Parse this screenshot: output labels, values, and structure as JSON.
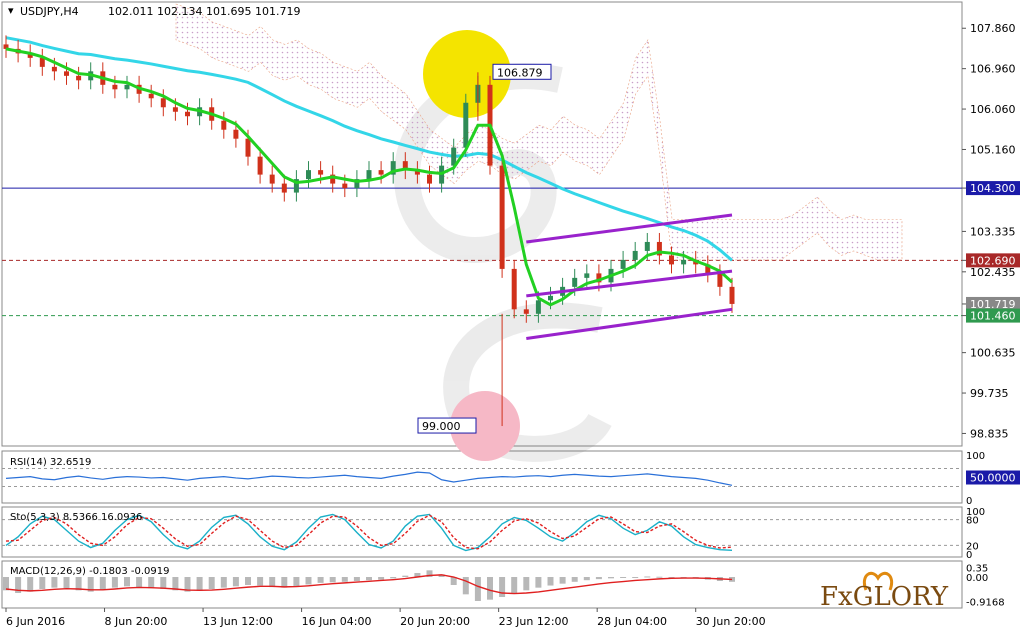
{
  "header": {
    "symbol": "USDJPY,H4",
    "quote": "102.011 102.134 101.695 101.719"
  },
  "brand": {
    "name": "FxGlory",
    "text": "FxGLORY"
  },
  "colors": {
    "bull": "#2e8b57",
    "bear": "#d0311b",
    "ma_green": "#22d022",
    "ma_cyan": "#33d6e8",
    "channel": "#9922cc",
    "level_blue": "#1a1aa8",
    "level_red": "#a82828",
    "level_green": "#2f9a4f",
    "rsi": "#2a70d8",
    "stoch_main": "#1ab0c8",
    "stoch_signal": "#e02020",
    "macd_hist": "#b8b8b8",
    "macd_signal": "#e02020"
  },
  "chart_data": [
    {
      "type": "candlestick",
      "title": "USDJPY,H4",
      "x_labels": [
        "6 Jun 2016",
        "8 Jun 20:00",
        "13 Jun 12:00",
        "16 Jun 04:00",
        "20 Jun 20:00",
        "23 Jun 12:00",
        "28 Jun 04:00",
        "30 Jun 20:00"
      ],
      "y_ticks": [
        "107.860",
        "106.960",
        "106.060",
        "105.160",
        "104.300",
        "103.335",
        "102.690",
        "102.435",
        "101.719",
        "101.460",
        "100.635",
        "99.735",
        "98.835"
      ],
      "ylim": [
        98.6,
        108.4
      ],
      "levels": [
        {
          "name": "resistance",
          "value": 104.3,
          "label": "104.300",
          "style": "solid",
          "color": "#1a1aa8"
        },
        {
          "name": "pivot",
          "value": 102.69,
          "label": "102.690",
          "style": "dashed",
          "color": "#a82828"
        },
        {
          "name": "last",
          "value": 101.719,
          "label": "101.719",
          "style": "none",
          "color": "#888888"
        },
        {
          "name": "support",
          "value": 101.46,
          "label": "101.460",
          "style": "dashed",
          "color": "#2f9a4f"
        }
      ],
      "annotations": [
        {
          "text": "106.879",
          "value": 106.879,
          "type": "high"
        },
        {
          "text": "99.000",
          "value": 99.0,
          "type": "low"
        }
      ],
      "close_path": [
        107.4,
        107.3,
        107.2,
        107.0,
        106.9,
        106.8,
        106.7,
        106.9,
        106.6,
        106.5,
        106.6,
        106.4,
        106.3,
        106.1,
        106.0,
        105.9,
        106.1,
        105.8,
        105.6,
        105.4,
        105.0,
        104.6,
        104.4,
        104.2,
        104.5,
        104.7,
        104.6,
        104.4,
        104.3,
        104.5,
        104.7,
        104.6,
        104.9,
        104.7,
        104.6,
        104.4,
        104.8,
        105.2,
        106.2,
        106.6,
        104.8,
        102.5,
        101.6,
        101.5,
        101.8,
        101.9,
        102.1,
        102.3,
        102.4,
        102.2,
        102.5,
        102.7,
        102.9,
        103.1,
        102.8,
        102.6,
        102.7,
        102.6,
        102.4,
        102.1,
        101.72
      ],
      "ichimoku_cloud": true,
      "moving_averages": [
        "fast",
        "slow"
      ],
      "channel": {
        "upper": [
          103.1,
          103.7
        ],
        "lower": [
          100.95,
          101.6
        ],
        "middle": [
          101.9,
          102.45
        ]
      }
    },
    {
      "type": "line",
      "title": "RSI(14) 32.6519",
      "y_ticks": [
        "100",
        "50.0000",
        "0"
      ],
      "ylim": [
        0,
        100
      ],
      "values": [
        48,
        50,
        52,
        47,
        45,
        50,
        53,
        49,
        46,
        50,
        52,
        51,
        49,
        50,
        47,
        44,
        48,
        50,
        52,
        49,
        47,
        50,
        53,
        52,
        50,
        49,
        51,
        53,
        55,
        52,
        50,
        48,
        53,
        57,
        62,
        60,
        45,
        40,
        44,
        48,
        50,
        52,
        51,
        53,
        54,
        52,
        55,
        57,
        55,
        53,
        52,
        54,
        56,
        58,
        55,
        52,
        50,
        48,
        44,
        38,
        32.65
      ]
    },
    {
      "type": "line",
      "title": "Sto(5,3,3) 8.5366 16.0936",
      "y_ticks": [
        "100",
        "80",
        "20",
        "0"
      ],
      "ylim": [
        0,
        100
      ],
      "series": [
        {
          "values": [
            20,
            40,
            70,
            88,
            80,
            55,
            30,
            15,
            25,
            55,
            80,
            90,
            75,
            45,
            20,
            12,
            30,
            62,
            85,
            90,
            70,
            40,
            18,
            10,
            28,
            60,
            86,
            92,
            80,
            50,
            22,
            14,
            30,
            65,
            88,
            92,
            60,
            20,
            8,
            15,
            40,
            70,
            85,
            78,
            60,
            40,
            30,
            50,
            75,
            90,
            82,
            60,
            45,
            55,
            75,
            65,
            40,
            22,
            15,
            10,
            8.54
          ]
        },
        {
          "values": [
            30,
            32,
            55,
            78,
            85,
            70,
            45,
            25,
            20,
            40,
            68,
            85,
            82,
            60,
            35,
            18,
            22,
            48,
            72,
            88,
            80,
            55,
            30,
            15,
            20,
            45,
            72,
            88,
            86,
            65,
            38,
            20,
            24,
            48,
            76,
            90,
            75,
            38,
            15,
            12,
            28,
            55,
            77,
            82,
            72,
            52,
            36,
            42,
            62,
            82,
            86,
            70,
            52,
            50,
            65,
            70,
            52,
            32,
            20,
            14,
            16.09
          ]
        }
      ]
    },
    {
      "type": "bar",
      "title": "MACD(12,26,9) -0.1803 -0.0919",
      "y_ticks": [
        "0.35",
        "0.00",
        "-0.9168"
      ],
      "ylim": [
        -1.05,
        0.45
      ],
      "histogram": [
        -0.5,
        -0.6,
        -0.55,
        -0.45,
        -0.4,
        -0.42,
        -0.5,
        -0.55,
        -0.48,
        -0.4,
        -0.35,
        -0.38,
        -0.42,
        -0.45,
        -0.5,
        -0.55,
        -0.52,
        -0.45,
        -0.4,
        -0.35,
        -0.3,
        -0.32,
        -0.38,
        -0.4,
        -0.35,
        -0.28,
        -0.22,
        -0.2,
        -0.18,
        -0.15,
        -0.12,
        -0.1,
        -0.05,
        0.05,
        0.15,
        0.25,
        0.1,
        -0.3,
        -0.65,
        -0.9,
        -0.85,
        -0.75,
        -0.6,
        -0.5,
        -0.4,
        -0.32,
        -0.25,
        -0.18,
        -0.12,
        -0.08,
        -0.05,
        -0.02,
        0.0,
        0.02,
        0.01,
        0.0,
        -0.02,
        -0.05,
        -0.1,
        -0.15,
        -0.18
      ],
      "signal": [
        -0.45,
        -0.5,
        -0.52,
        -0.5,
        -0.46,
        -0.44,
        -0.45,
        -0.48,
        -0.48,
        -0.45,
        -0.41,
        -0.39,
        -0.4,
        -0.42,
        -0.45,
        -0.49,
        -0.5,
        -0.49,
        -0.46,
        -0.42,
        -0.38,
        -0.35,
        -0.35,
        -0.37,
        -0.36,
        -0.33,
        -0.29,
        -0.25,
        -0.22,
        -0.19,
        -0.16,
        -0.13,
        -0.1,
        -0.06,
        0.0,
        0.06,
        0.08,
        0.0,
        -0.15,
        -0.35,
        -0.5,
        -0.6,
        -0.62,
        -0.6,
        -0.56,
        -0.5,
        -0.44,
        -0.38,
        -0.32,
        -0.26,
        -0.21,
        -0.17,
        -0.13,
        -0.1,
        -0.07,
        -0.05,
        -0.04,
        -0.04,
        -0.05,
        -0.07,
        -0.09
      ]
    }
  ]
}
